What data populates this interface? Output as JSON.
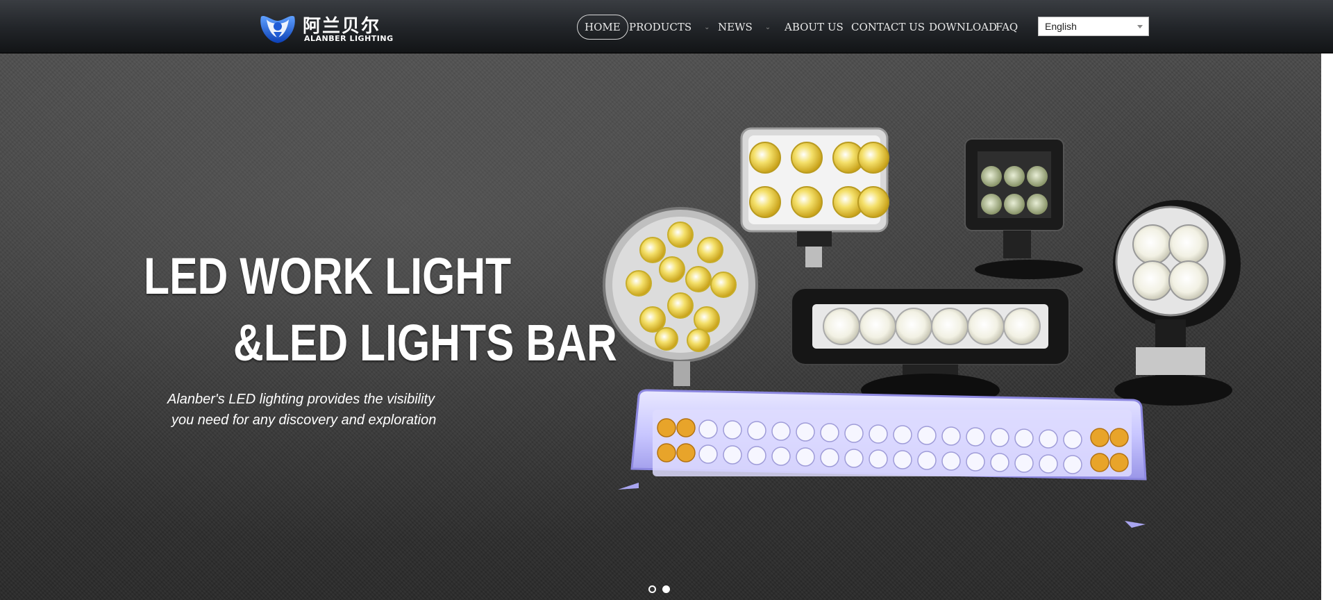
{
  "brand": {
    "name_cn": "阿兰贝尔",
    "name_en": "ALANBER LIGHTING",
    "logo_icon": "alanber-logo-icon"
  },
  "nav": {
    "items": [
      {
        "label": "HOME",
        "active": true
      },
      {
        "label": "PRODUCTS",
        "has_dropdown": true
      },
      {
        "label": "NEWS",
        "has_dropdown": true
      },
      {
        "label": "ABOUT US"
      },
      {
        "label": "CONTACT US"
      },
      {
        "label": "DOWNLOAD"
      },
      {
        "label": "FAQ"
      }
    ],
    "dropdown_icon": "chevron-down-icon"
  },
  "language": {
    "selected": "English",
    "icon": "dropdown-arrow-icon"
  },
  "hero": {
    "title_line1": "LED WORK LIGHT",
    "title_line2": "&LED LIGHTS BAR",
    "subtitle_line1": "Alanber's LED lighting provides the visibility",
    "subtitle_line2": "you need for any discovery and exploration",
    "slide_count": 2,
    "active_slide": 1
  },
  "colors": {
    "header_top": "#3a3d42",
    "header_bottom": "#121416",
    "hero_bg": "#333333",
    "logo_blue": "#1e5bd6",
    "light_bar_glow": "#c8c6ff",
    "amber_led": "#e8a42a",
    "yellow_led": "#f2d43a"
  }
}
